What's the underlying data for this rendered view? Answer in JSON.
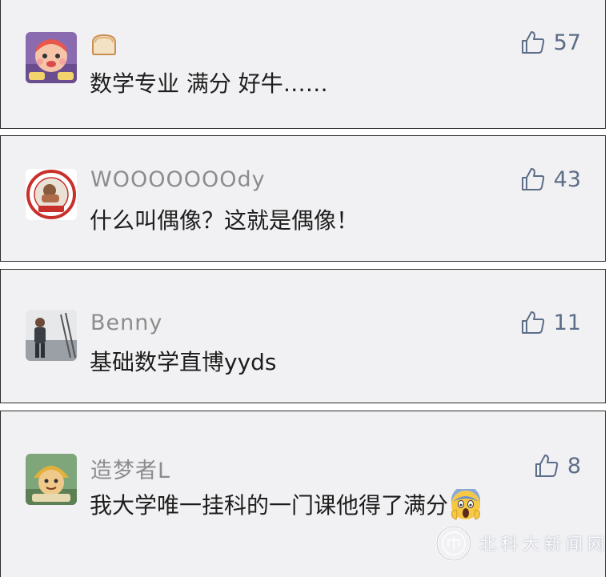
{
  "comments": [
    {
      "author": "",
      "author_icon": "bread-emoji-icon",
      "text": "数学专业 满分 好牛……",
      "likes": "57"
    },
    {
      "author": "WOOOOOOOdy",
      "text": "什么叫偶像？这就是偶像！",
      "likes": "43"
    },
    {
      "author": "Benny",
      "text": "基础数学直博yyds",
      "likes": "11"
    },
    {
      "author": "造梦者L",
      "text": "我大学唯一挂科的一门课他得了满分",
      "trailing_emoji": "screaming-face-emoji-icon",
      "likes": "8"
    }
  ],
  "watermark": {
    "text": "北科大新闻网"
  },
  "colors": {
    "card_background": "#f1f1f3",
    "card_border": "#2b2b2b",
    "author_name": "#8c8c8c",
    "comment_text": "#1d1d1d",
    "like_accent": "#5c6d88"
  }
}
